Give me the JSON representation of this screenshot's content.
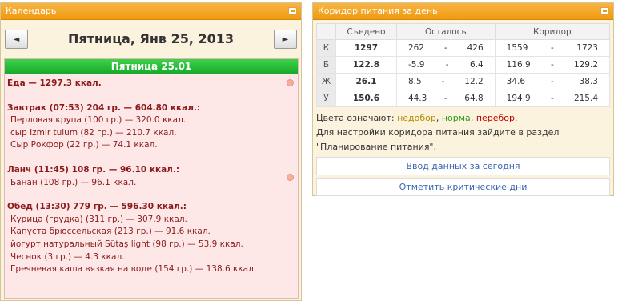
{
  "calendar": {
    "header_title": "Календарь",
    "date_title": "Пятница, Янв 25, 2013",
    "prev_label": "◄",
    "next_label": "►",
    "day_label": "Пятница 25.01",
    "food_total": "Еда — 1297.3 ккал.",
    "meals": [
      {
        "title": "Завтрак (07:53) 204 гр. — 604.80 ккал.:",
        "items": [
          "Перловая крупа (100 гр.) — 320.0 ккал.",
          "сыр Izmir tulum (82 гр.) — 210.7 ккал.",
          "Сыр Рокфор (22 гр.) — 74.1 ккал."
        ]
      },
      {
        "title": "Ланч (11:45) 108 гр. — 96.10 ккал.:",
        "items": [
          "Банан (108 гр.) — 96.1 ккал."
        ]
      },
      {
        "title": "Обед (13:30) 779 гр. — 596.30 ккал.:",
        "items": [
          "Курица (грудка) (311 гр.) — 307.9 ккал.",
          "Капуста брюссельская (213 гр.) — 91.6 ккал.",
          "йогурт натуральный Sütaş light (98 гр.) — 53.9 ккал.",
          "Чеснок (3 гр.) — 4.3 ккал.",
          "Гречневая каша вязкая на воде (154 гр.) — 138.6 ккал."
        ]
      }
    ]
  },
  "corridor": {
    "header_title": "Коридор питания за день",
    "columns": [
      "Съедено",
      "Осталось",
      "Коридор"
    ],
    "rows": [
      {
        "label": "К",
        "eaten": "1297",
        "eaten_status": "low",
        "left_min": "262",
        "sep1": "-",
        "left_max": "426",
        "cor_min": "1559",
        "sep2": "-",
        "cor_max": "1723"
      },
      {
        "label": "Б",
        "eaten": "122.8",
        "eaten_status": "ok",
        "left_min": "-5.9",
        "sep1": "-",
        "left_max": "6.4",
        "cor_min": "116.9",
        "sep2": "-",
        "cor_max": "129.2"
      },
      {
        "label": "Ж",
        "eaten": "26.1",
        "eaten_status": "low",
        "left_min": "8.5",
        "sep1": "-",
        "left_max": "12.2",
        "cor_min": "34.6",
        "sep2": "-",
        "cor_max": "38.3"
      },
      {
        "label": "У",
        "eaten": "150.6",
        "eaten_status": "low",
        "left_min": "44.3",
        "sep1": "-",
        "left_max": "64.8",
        "cor_min": "194.9",
        "sep2": "-",
        "cor_max": "215.4"
      }
    ],
    "legend_prefix": "Цвета означают:",
    "legend_low": "недобор",
    "legend_ok": "норма",
    "legend_over": "перебор.",
    "hint_line1": "Для настройки коридора питания зайдите в раздел",
    "hint_line2": "\"Планирование питания\".",
    "button_enter": "Ввод данных за сегодня",
    "button_critical": "Отметить критические дни",
    "colors": {
      "low": "#b09000",
      "ok": "#3f8f2f",
      "over": "#c00000"
    }
  }
}
